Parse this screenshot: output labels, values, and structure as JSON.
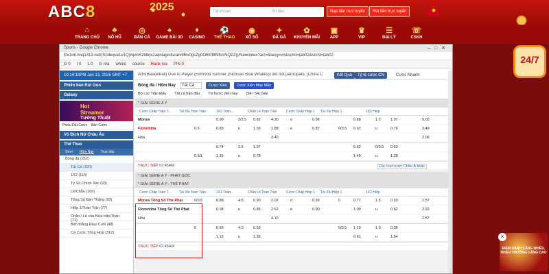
{
  "site": {
    "logo_main": "ABC",
    "logo_num": "8",
    "banner": "2025",
    "login_placeholder": "Tài khoản",
    "pass_placeholder": "Số tiền",
    "register": "Nạp tiền trực tuyến",
    "deposit": "Rút tiền trực tuyến"
  },
  "nav": [
    "TRANG CHỦ",
    "NỔ HŨ",
    "BẮN CÁ",
    "GAME BÀI 3D",
    "CASINO",
    "THỂ THAO",
    "XỔ SỐ",
    "ĐÁ GÀ",
    "KHUYẾN MÃI",
    "APP",
    "VIP",
    "ĐẠI LÝ",
    "CSKH"
  ],
  "side_badge": "24/7",
  "promo": "ĐIỂM DANH CĂNG NHIỀU, NHẬN THƯỞNG CÀNG CAO",
  "browser": {
    "title": "Sports - Google Chrome",
    "url": "l0v1ob.hnq1313.net/(S(ideqse1e1Q)ivpmSzbbrjx2aqniagcdscarv9Ru0gsZg0O6t0f8f9fcrrNQZZ))/Newindex?act=&lang=vn&scmt=tab02&scmt=tab02",
    "ext": [
      "G 0",
      "I 0",
      "L 0",
      "b: n/a",
      "whois",
      "source",
      "Rank n/a",
      "PIN 0"
    ]
  },
  "left": {
    "time": "10:14:18PM Jan 13, 2025 GMT +7",
    "bar1": "Phiên bản Rút Gọn",
    "bar2": "Galaxy",
    "banner_title": "Hot Streamer",
    "banner_sub": "Tường Thuật",
    "tabs": [
      "Phiếu Đặt Cược",
      "Bàn Cược"
    ],
    "bar3": "Vô Địch Nữ Châu Âu",
    "bar4": "Thể Thao",
    "subtabs": [
      "Sớm",
      "Hôm Nay",
      "Trực tiếp"
    ],
    "items": [
      "Bóng đá (212)",
      "Tất Cả (190)",
      "1X2 (110)",
      "Tỷ Số Chính Xác (93)",
      "Lẻ/Chẵn (109)",
      "Tổng Số Bàn Thắng (93)",
      "Hiệp 1/Toàn Trận (77)",
      "Chẵn / Lẻ của Nửa trận/Toàn (71)",
      "Bàn thắng Đầu/ Cuối (48)",
      "Cá Cược Tổng Hợp (312)"
    ]
  },
  "main": {
    "announce": "Attn(Basketball) Due to Player (Edmond Sumner (Sichuan Blue Whales)) did not participate, [China CB...",
    "btn_back": "Kết Quả",
    "btn_type": "Tỷ lệ cược CN",
    "btn_fast": "Cược Nhanh",
    "sport": "Bóng đá / Hôm Nay",
    "all": "Tất Cả",
    "xien": "Cược Xiên",
    "xien2": "Cược Xiên May Mắn",
    "filter1": "Bộ Lọc Trận Đấu",
    "filter2": "Tất cả trận đấu",
    "filter3": "Từ trước đến nay",
    "count": "(54 / 54) Giải",
    "league1": "* GIẢI SERIE A Ý",
    "league2": "* GIẢI SERIE A Ý - PHẠT GÓC",
    "league3": "* GIẢI SERIE A Ý - THẺ PHẠT",
    "headers": [
      "Cược Chấp Toàn T...",
      "Tài Xỉu Toàn Trận",
      "1X2 Toàn...",
      "Chẵn Lẻ Toàn Trận",
      "Cược Chấp Hiệp 1",
      "Tài Xỉu Hiệp 1",
      "1X2 Hiệp"
    ],
    "home": "Monza",
    "away": "Fiorentina",
    "draw": "Hòa",
    "home2": "Monza Tổng Số Thẻ Phạt",
    "away2": "Fiorentina Tổng Số Thẻ Phạt",
    "live": "TRỰC TIẾP",
    "live_time": "02:45AM",
    "more": "Các loại cược Châu Á khác",
    "rows1": [
      [
        "",
        "0.99",
        "2/2.5",
        "0.82",
        "4.30",
        "o",
        "0.98",
        "",
        "0.88",
        "1.0",
        "1.07",
        "5.00"
      ],
      [
        "0.5",
        "0.89",
        "u",
        "1.03",
        "1.88",
        "e",
        "0.87",
        "0/0.5",
        "0.97",
        "u",
        "0.76",
        "2.49"
      ],
      [
        "",
        "",
        "",
        "",
        "3.40",
        "",
        "",
        "",
        "",
        "",
        "",
        "2.06"
      ]
    ],
    "rows2": [
      [
        "",
        "0.74",
        "2.5",
        "1.07",
        "",
        "",
        "",
        "",
        "0.52",
        "0/0.5",
        "0.63",
        ""
      ],
      [
        "0.5/1",
        "1.16",
        "u",
        "0.78",
        "",
        "",
        "",
        "",
        "1.49",
        "u",
        "1.28",
        ""
      ]
    ],
    "rows3": [
      [
        "0/0.5",
        "0.88",
        "4.5",
        "0.90",
        "2.02",
        "o",
        "0.93",
        "0",
        "0.77",
        "1.5",
        "0.93",
        "2.57"
      ],
      [
        "",
        "0.98",
        "u",
        "0.85",
        "2.62",
        "e",
        "0.90",
        "",
        "1.09",
        "u",
        "0.82",
        "2.92"
      ],
      [
        "",
        "",
        "",
        "",
        "4.10",
        "",
        "",
        "",
        "",
        "",
        "",
        "2.57"
      ]
    ],
    "rows4": [
      [
        "0",
        "0.66",
        "4.0",
        "0.53",
        "",
        "",
        "",
        "0/0.5",
        "1.19",
        "1.0",
        "0.38",
        ""
      ],
      [
        "",
        "1.12",
        "u",
        "1.28",
        "",
        "",
        "",
        "",
        "0.61",
        "u",
        "1.54",
        ""
      ]
    ]
  }
}
